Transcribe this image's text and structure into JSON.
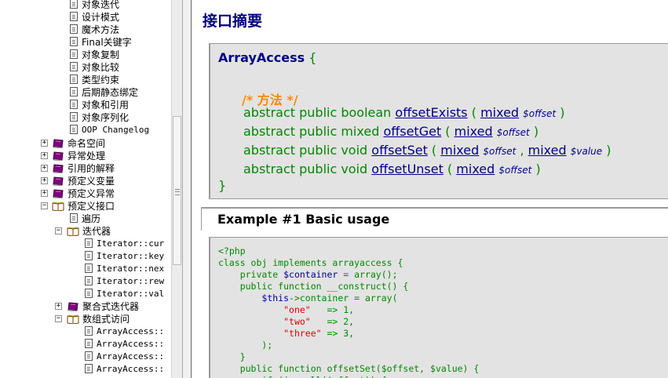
{
  "sidebar": {
    "top_items": [
      "对象迭代",
      "设计模式",
      "魔术方法",
      "Final关键字",
      "对象复制",
      "对象比较",
      "类型约束",
      "后期静态绑定",
      "对象和引用",
      "对象序列化",
      "OOP Changelog"
    ],
    "chapters": [
      {
        "label": "命名空间",
        "toggle": "+",
        "open": false
      },
      {
        "label": "异常处理",
        "toggle": "+",
        "open": false
      },
      {
        "label": "引用的解释",
        "toggle": "+",
        "open": false
      },
      {
        "label": "预定义变量",
        "toggle": "+",
        "open": false
      },
      {
        "label": "预定义异常",
        "toggle": "+",
        "open": false
      },
      {
        "label": "预定义接口",
        "toggle": "−",
        "open": true
      }
    ],
    "predef": {
      "traverse": "遍历",
      "iterator": {
        "label": "迭代器",
        "toggle": "−"
      },
      "iterator_items": [
        "Iterator::cur",
        "Iterator::key",
        "Iterator::nex",
        "Iterator::rew",
        "Iterator::val"
      ],
      "aggregate": {
        "label": "聚合式迭代器",
        "toggle": "+"
      },
      "arrayaccess": {
        "label": "数组式访问",
        "toggle": "−"
      },
      "arrayaccess_items": [
        "ArrayAccess::",
        "ArrayAccess::",
        "ArrayAccess::",
        "ArrayAccess::"
      ]
    }
  },
  "content": {
    "page_title": "接口摘要",
    "summary": {
      "class_name": "ArrayAccess",
      "open_brace": "{",
      "comment": "/* 方法 */",
      "methods": [
        {
          "prefix": "abstract public boolean",
          "name": "offsetExists",
          "params": [
            {
              "type": "mixed",
              "name": "$offset"
            }
          ]
        },
        {
          "prefix": "abstract public mixed",
          "name": "offsetGet",
          "params": [
            {
              "type": "mixed",
              "name": "$offset"
            }
          ]
        },
        {
          "prefix": "abstract public void",
          "name": "offsetSet",
          "params": [
            {
              "type": "mixed",
              "name": "$offset"
            },
            {
              "type": "mixed",
              "name": "$value"
            }
          ]
        },
        {
          "prefix": "abstract public void",
          "name": "offsetUnset",
          "params": [
            {
              "type": "mixed",
              "name": "$offset"
            }
          ]
        }
      ],
      "close_brace": "}"
    },
    "example": {
      "title": "Example #1 Basic usage",
      "code_lines": [
        [
          {
            "t": "<?php",
            "c": "p"
          }
        ],
        [
          {
            "t": "class obj implements arrayaccess {",
            "c": "p"
          }
        ],
        [
          {
            "t": "    private ",
            "c": "p"
          },
          {
            "t": "$container",
            "c": "v"
          },
          {
            "t": " = array();",
            "c": "p"
          }
        ],
        [
          {
            "t": "    public function __construct() {",
            "c": "p"
          }
        ],
        [
          {
            "t": "        ",
            "c": "p"
          },
          {
            "t": "$this",
            "c": "v"
          },
          {
            "t": "->container = array(",
            "c": "p"
          }
        ],
        [
          {
            "t": "            ",
            "c": "p"
          },
          {
            "t": "\"one\"",
            "c": "s"
          },
          {
            "t": "   => 1,",
            "c": "p"
          }
        ],
        [
          {
            "t": "            ",
            "c": "p"
          },
          {
            "t": "\"two\"",
            "c": "s"
          },
          {
            "t": "   => 2,",
            "c": "p"
          }
        ],
        [
          {
            "t": "            ",
            "c": "p"
          },
          {
            "t": "\"three\"",
            "c": "s"
          },
          {
            "t": " => 3,",
            "c": "p"
          }
        ],
        [
          {
            "t": "        );",
            "c": "p"
          }
        ],
        [
          {
            "t": "    }",
            "c": "p"
          }
        ],
        [
          {
            "t": "    public function offsetSet($offset, $value) {",
            "c": "p"
          }
        ],
        [
          {
            "t": "        if (is_null($offset)) {",
            "c": "p"
          }
        ]
      ]
    }
  }
}
